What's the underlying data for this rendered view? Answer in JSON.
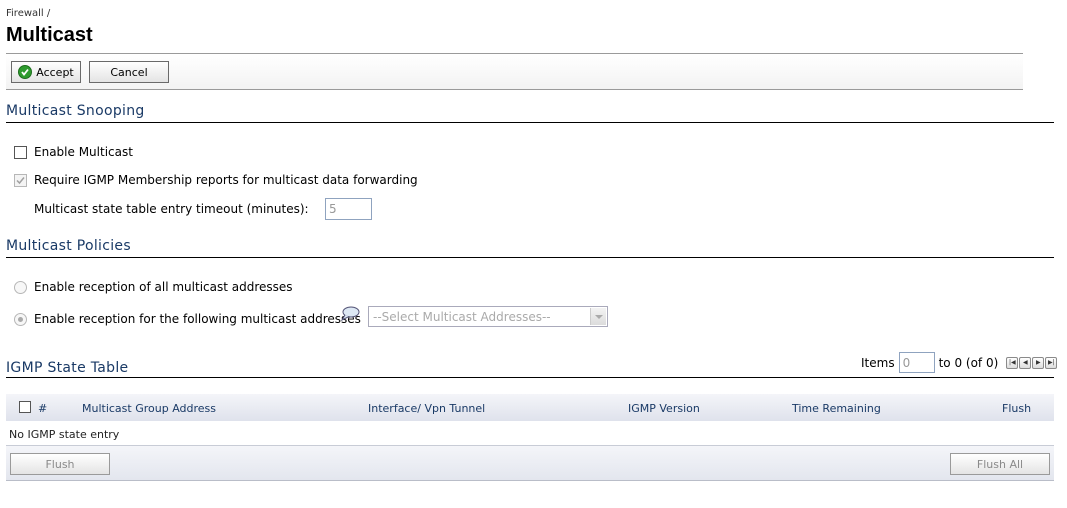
{
  "breadcrumb": "Firewall /",
  "title": "Multicast",
  "toolbar": {
    "accept_label": "Accept",
    "cancel_label": "Cancel"
  },
  "snooping": {
    "heading": "Multicast Snooping",
    "enable_multicast": {
      "label": "Enable Multicast",
      "checked": false
    },
    "require_igmp": {
      "label": "Require IGMP Membership reports for multicast data forwarding",
      "checked": true,
      "disabled": true
    },
    "timeout": {
      "label": "Multicast state table entry timeout (minutes):",
      "value": "5"
    }
  },
  "policies": {
    "heading": "Multicast Policies",
    "option_all": {
      "label": "Enable reception of all multicast addresses"
    },
    "option_following": {
      "label": "Enable reception for the following multicast addresses"
    },
    "select": {
      "value": "--Select Multicast Addresses--"
    }
  },
  "igmp": {
    "heading": "IGMP State Table",
    "items_label": "Items",
    "items_value": "0",
    "range_text": "to 0 (of 0)",
    "columns": {
      "number": "#",
      "group_address": "Multicast Group Address",
      "interface": "Interface/ Vpn Tunnel",
      "version": "IGMP Version",
      "time_remaining": "Time Remaining",
      "flush": "Flush"
    },
    "empty_message": "No IGMP state entry",
    "flush_label": "Flush",
    "flush_all_label": "Flush All"
  },
  "colors": {
    "heading": "#1a3a66",
    "accept_icon": "#2e9b2e"
  }
}
